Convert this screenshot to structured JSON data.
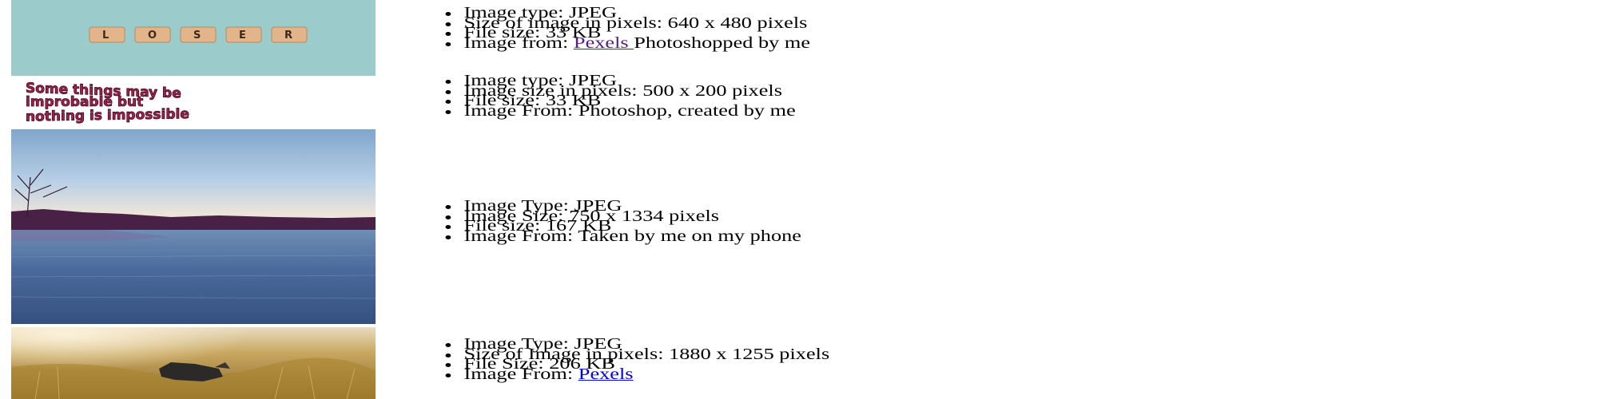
{
  "items": [
    {
      "image": {
        "name": "loser-scrabble-tiles",
        "tiles": [
          "L",
          "O",
          "S",
          "E",
          "R"
        ]
      },
      "lines": [
        {
          "label": "Image type: JPEG"
        },
        {
          "label": "Size of image in pixels: 640 x 480 pixels"
        },
        {
          "label": "File size: 33 KB"
        },
        {
          "label": "Image from: ",
          "link": "Pexels ",
          "tail": "Photoshopped by me",
          "link_visited": true
        }
      ]
    },
    {
      "image": {
        "name": "warped-quote-text",
        "text_lines": [
          "Some things may be",
          "improbable but",
          "nothing is impossible"
        ]
      },
      "lines": [
        {
          "label": "Image type: JPEG"
        },
        {
          "label": "Image size in pixels: 500 x 200 pixels"
        },
        {
          "label": "File size: 33 KB"
        },
        {
          "label": "Image From: Photoshop, created by me"
        }
      ]
    },
    {
      "image": {
        "name": "lake-photo"
      },
      "lines": [
        {
          "label": "Image Type: JPEG"
        },
        {
          "label": "Image Size: 750 x 1334 pixels"
        },
        {
          "label": "File size: 167 KB"
        },
        {
          "label": "Image From: Taken by me on my phone"
        }
      ]
    },
    {
      "image": {
        "name": "dog-in-field-photo"
      },
      "lines": [
        {
          "label": "Image Type: JPEG"
        },
        {
          "label": "Size of Image in pixels: 1880 x 1255 pixels"
        },
        {
          "label": "File Size: 206 KB"
        },
        {
          "label": "Image From: ",
          "link": "Pexels",
          "tail": "",
          "link_visited": false
        }
      ]
    }
  ],
  "colors": {
    "teal_bg": "#9ccbcb",
    "tile": "#e2b48a",
    "quote_text": "#a3204d",
    "sky_top": "#7fa6cc",
    "water": "#3c5a8c",
    "treeline": "#4a2146",
    "field": "#c79a45",
    "visited_link": "#551a8b",
    "link": "#0000ee"
  }
}
